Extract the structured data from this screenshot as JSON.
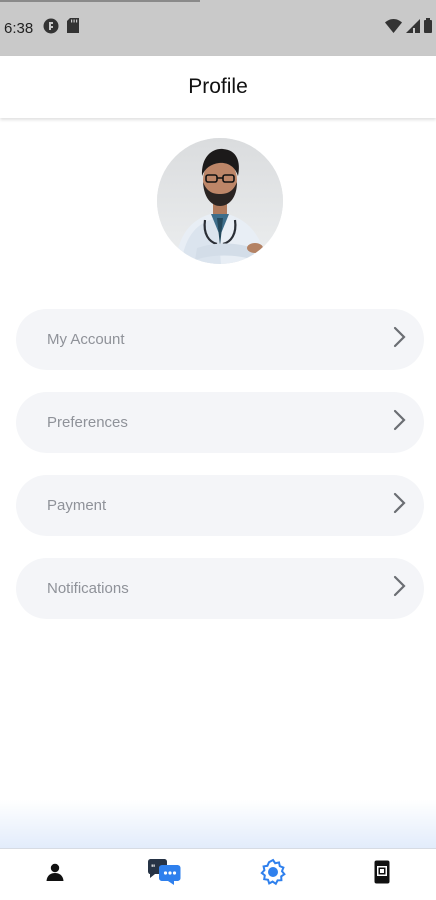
{
  "status_bar": {
    "time": "6:38",
    "left_icons": [
      "app-icon",
      "sd-card-icon"
    ],
    "right_icons": [
      "wifi-icon",
      "signal-icon",
      "battery-icon"
    ]
  },
  "header": {
    "title": "Profile"
  },
  "avatar": {
    "alt": "Doctor profile photo"
  },
  "menu": {
    "items": [
      {
        "label": "My Account",
        "icon": "chevron-right-icon"
      },
      {
        "label": "Preferences",
        "icon": "chevron-right-icon"
      },
      {
        "label": "Payment",
        "icon": "chevron-right-icon"
      },
      {
        "label": "Notifications",
        "icon": "chevron-right-icon"
      }
    ]
  },
  "bottom_nav": {
    "tabs": [
      {
        "icon": "person-icon"
      },
      {
        "icon": "chat-icon"
      },
      {
        "icon": "settings-icon",
        "active": true
      },
      {
        "icon": "phone-icon"
      }
    ]
  },
  "colors": {
    "accent": "#2f80ed",
    "menu_bg": "#f4f5f8",
    "menu_text": "#8f9299",
    "status_bar_bg": "#c9c9c9"
  }
}
